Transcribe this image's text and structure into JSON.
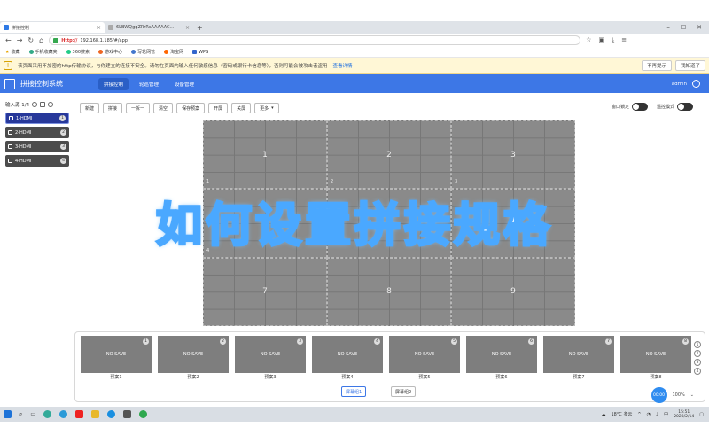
{
  "browser": {
    "tabs": [
      {
        "label": "拼接控制",
        "active": true
      },
      {
        "label": "6LBWQgqZRrRsAAAAAC...",
        "active": false
      }
    ],
    "new_tab": "+",
    "url_prefix": "Http://",
    "url": "192.168.1.185/#/app",
    "bookmarks": [
      "收藏",
      "手机收藏夹",
      "360搜索",
      "游戏中心",
      "写轮网管",
      "淘宝网",
      "WPS"
    ],
    "notice_text": "该页面采用不加密的http传输协议，与你建立的连接不安全。请勿在页面内输入任何敏感信息（密码或银行卡信息等），否则可能会被攻击者盗用",
    "notice_link": "查看详情",
    "notice_btn1": "不再提示",
    "notice_btn2": "我知道了"
  },
  "app": {
    "title": "拼接控制系统",
    "menu": [
      {
        "label": "拼接控制",
        "active": true
      },
      {
        "label": "轮巡管理",
        "active": false
      },
      {
        "label": "设备管理",
        "active": false
      }
    ],
    "user": "admin"
  },
  "sources": {
    "header": "输入源 1/4",
    "items": [
      {
        "label": "1-HDMI",
        "num": "1",
        "active": true
      },
      {
        "label": "2-HDMI",
        "num": "2",
        "active": false
      },
      {
        "label": "3-HDMI",
        "num": "3",
        "active": false
      },
      {
        "label": "4-HDMI",
        "num": "4",
        "active": false
      }
    ]
  },
  "toolbar": [
    "新建",
    "拼接",
    "一拆一",
    "清空",
    "保存预案",
    "开屏",
    "关屏",
    "更多"
  ],
  "toggles": [
    {
      "label": "窗口锁定"
    },
    {
      "label": "遥控模式"
    }
  ],
  "wall": {
    "cells": [
      {
        "label": "1",
        "sub": "1"
      },
      {
        "label": "2",
        "sub": "2"
      },
      {
        "label": "3",
        "sub": "3"
      },
      {
        "label": "",
        "sub": "4"
      },
      {
        "label": "",
        "sub": ""
      },
      {
        "label": "",
        "sub": ""
      },
      {
        "label": "7",
        "sub": ""
      },
      {
        "label": "8",
        "sub": ""
      },
      {
        "label": "9",
        "sub": ""
      }
    ]
  },
  "overlay_title": "如何设置拼接规格",
  "presets": {
    "items": [
      {
        "thumb": "NO SAVE",
        "num": "1",
        "label": "预案1"
      },
      {
        "thumb": "NO SAVE",
        "num": "2",
        "label": "预案2"
      },
      {
        "thumb": "NO SAVE",
        "num": "3",
        "label": "预案3"
      },
      {
        "thumb": "NO SAVE",
        "num": "4",
        "label": "预案4"
      },
      {
        "thumb": "NO SAVE",
        "num": "5",
        "label": "预案5"
      },
      {
        "thumb": "NO SAVE",
        "num": "6",
        "label": "预案6"
      },
      {
        "thumb": "NO SAVE",
        "num": "7",
        "label": "预案7"
      },
      {
        "thumb": "NO SAVE",
        "num": "8",
        "label": "预案8"
      }
    ],
    "side_nums": [
      "1",
      "2",
      "3",
      "4"
    ],
    "pages": [
      "屏幕组1",
      "屏幕组2"
    ],
    "zoom_bubble": "00:00",
    "zoom": "100%"
  },
  "taskbar": {
    "weather": "18°C 多云",
    "ime": "中",
    "time": "15:51",
    "date": "2023/2/14"
  }
}
